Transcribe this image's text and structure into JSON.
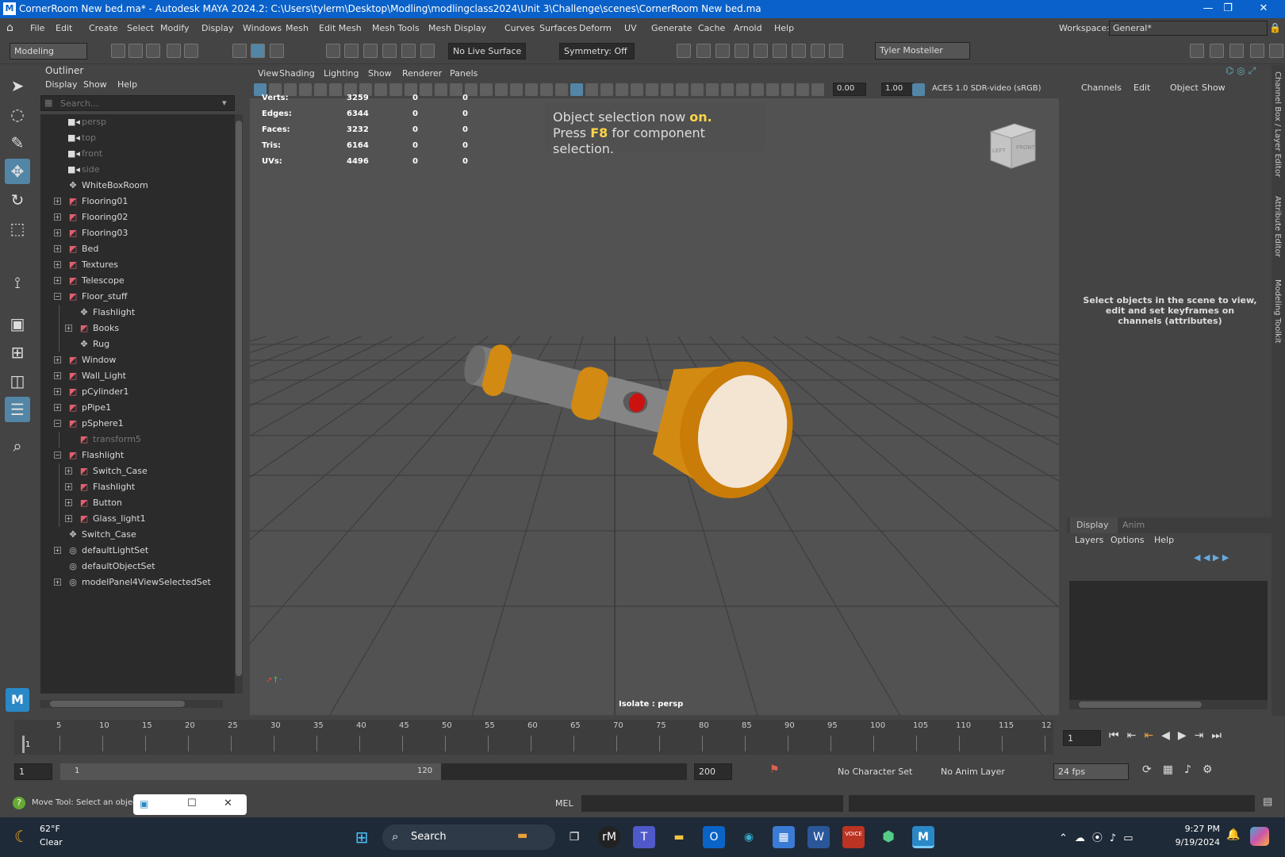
{
  "titlebar": {
    "logo": "M",
    "title": "CornerRoom New bed.ma* - Autodesk MAYA 2024.2: C:\\Users\\tylerm\\Desktop\\Modling\\modlingclass2024\\Unit 3\\Challenge\\scenes\\CornerRoom New bed.ma",
    "min": "—",
    "max": "❐",
    "close": "✕"
  },
  "menubar": {
    "items": [
      "File",
      "Edit",
      "Create",
      "Select",
      "Modify",
      "Display",
      "Windows",
      "Mesh",
      "Edit Mesh",
      "Mesh Tools",
      "Mesh Display",
      "Curves",
      "Surfaces",
      "Deform",
      "UV",
      "Generate",
      "Cache",
      "Arnold",
      "Help"
    ],
    "workspace_label": "Workspace:",
    "workspace_value": "General*"
  },
  "statusline": {
    "mode": "Modeling",
    "live_surface": "No Live Surface",
    "symmetry": "Symmetry: Off",
    "user": "Tyler Mosteller"
  },
  "outliner": {
    "title": "Outliner",
    "menus": [
      "Display",
      "Show",
      "Help"
    ],
    "search_placeholder": "Search...",
    "items": [
      {
        "label": "persp",
        "indent": 0,
        "icon": "camera-icon",
        "dim": true,
        "exp": ""
      },
      {
        "label": "top",
        "indent": 0,
        "icon": "camera-icon",
        "dim": true,
        "exp": ""
      },
      {
        "label": "front",
        "indent": 0,
        "icon": "camera-icon",
        "dim": true,
        "exp": ""
      },
      {
        "label": "side",
        "indent": 0,
        "icon": "camera-icon",
        "dim": true,
        "exp": ""
      },
      {
        "label": "WhiteBoxRoom",
        "indent": 0,
        "icon": "group-icon",
        "dim": false,
        "exp": ""
      },
      {
        "label": "Flooring01",
        "indent": 0,
        "icon": "mesh-icon",
        "dim": false,
        "exp": "+"
      },
      {
        "label": "Flooring02",
        "indent": 0,
        "icon": "mesh-icon",
        "dim": false,
        "exp": "+"
      },
      {
        "label": "Flooring03",
        "indent": 0,
        "icon": "mesh-icon",
        "dim": false,
        "exp": "+"
      },
      {
        "label": "Bed",
        "indent": 0,
        "icon": "mesh-icon",
        "dim": false,
        "exp": "+"
      },
      {
        "label": "Textures",
        "indent": 0,
        "icon": "mesh-icon",
        "dim": false,
        "exp": "+"
      },
      {
        "label": "Telescope",
        "indent": 0,
        "icon": "mesh-icon",
        "dim": false,
        "exp": "+"
      },
      {
        "label": "Floor_stuff",
        "indent": 0,
        "icon": "mesh-icon",
        "dim": false,
        "exp": "−"
      },
      {
        "label": "Flashlight",
        "indent": 1,
        "icon": "group-icon",
        "dim": false,
        "exp": ""
      },
      {
        "label": "Books",
        "indent": 1,
        "icon": "mesh-icon",
        "dim": false,
        "exp": "+"
      },
      {
        "label": "Rug",
        "indent": 1,
        "icon": "group-icon",
        "dim": false,
        "exp": ""
      },
      {
        "label": "Window",
        "indent": 0,
        "icon": "mesh-icon",
        "dim": false,
        "exp": "+"
      },
      {
        "label": "Wall_Light",
        "indent": 0,
        "icon": "mesh-icon",
        "dim": false,
        "exp": "+"
      },
      {
        "label": "pCylinder1",
        "indent": 0,
        "icon": "mesh-icon",
        "dim": false,
        "exp": "+"
      },
      {
        "label": "pPipe1",
        "indent": 0,
        "icon": "mesh-icon",
        "dim": false,
        "exp": "+"
      },
      {
        "label": "pSphere1",
        "indent": 0,
        "icon": "mesh-icon",
        "dim": false,
        "exp": "−"
      },
      {
        "label": "transform5",
        "indent": 1,
        "icon": "mesh-icon",
        "dim": true,
        "exp": ""
      },
      {
        "label": "Flashlight",
        "indent": 0,
        "icon": "mesh-icon",
        "dim": false,
        "exp": "−"
      },
      {
        "label": "Switch_Case",
        "indent": 1,
        "icon": "mesh-icon",
        "dim": false,
        "exp": "+"
      },
      {
        "label": "Flashlight",
        "indent": 1,
        "icon": "mesh-icon",
        "dim": false,
        "exp": "+"
      },
      {
        "label": "Button",
        "indent": 1,
        "icon": "mesh-icon",
        "dim": false,
        "exp": "+"
      },
      {
        "label": "Glass_light1",
        "indent": 1,
        "icon": "mesh-icon",
        "dim": false,
        "exp": "+"
      },
      {
        "label": "Switch_Case",
        "indent": 0,
        "icon": "group-icon",
        "dim": false,
        "exp": ""
      },
      {
        "label": "defaultLightSet",
        "indent": 0,
        "icon": "set-icon",
        "dim": false,
        "exp": "+"
      },
      {
        "label": "defaultObjectSet",
        "indent": 0,
        "icon": "set-icon",
        "dim": false,
        "exp": ""
      },
      {
        "label": "modelPanel4ViewSelectedSet",
        "indent": 0,
        "icon": "set-icon",
        "dim": false,
        "exp": "+"
      }
    ]
  },
  "viewport": {
    "menus": [
      "View",
      "Shading",
      "Lighting",
      "Show",
      "Renderer",
      "Panels"
    ],
    "exposure": "0.00",
    "gamma": "1.00",
    "colorspace": "ACES 1.0 SDR-video (sRGB)",
    "stats": [
      {
        "label": "Verts:",
        "v1": "3259",
        "v2": "0",
        "v3": "0"
      },
      {
        "label": "Edges:",
        "v1": "6344",
        "v2": "0",
        "v3": "0"
      },
      {
        "label": "Faces:",
        "v1": "3232",
        "v2": "0",
        "v3": "0"
      },
      {
        "label": "Tris:",
        "v1": "6164",
        "v2": "0",
        "v3": "0"
      },
      {
        "label": "UVs:",
        "v1": "4496",
        "v2": "0",
        "v3": "0"
      }
    ],
    "notice_line1_a": "Object selection now ",
    "notice_line1_b": "on.",
    "notice_line2_a": "Press ",
    "notice_line2_b": "F8",
    "notice_line2_c": " for component selection.",
    "viewcube_left": "LEFT",
    "viewcube_front": "FRONT",
    "isolate": "Isolate : persp",
    "colors": {
      "body": "#7b7b7b",
      "accent": "#d28a12",
      "button": "#cc1111",
      "lens": "#f4e4d2"
    }
  },
  "channels": {
    "menus": [
      "Channels",
      "Edit",
      "Object",
      "Show"
    ],
    "hint": "Select objects in the scene to view, edit and set keyframes on channels (attributes)",
    "tabs": [
      "Display",
      "Anim"
    ],
    "layer_menus": [
      "Layers",
      "Options",
      "Help"
    ]
  },
  "sidetabs": [
    "Channel Box / Layer Editor",
    "Attribute Editor",
    "Modeling Toolkit"
  ],
  "timeslider": {
    "ticks": [
      "5",
      "10",
      "15",
      "20",
      "25",
      "30",
      "35",
      "40",
      "45",
      "50",
      "55",
      "60",
      "65",
      "70",
      "75",
      "80",
      "85",
      "90",
      "95",
      "100",
      "105",
      "110",
      "115",
      "12"
    ],
    "current": "1",
    "current_field": "1"
  },
  "rangebar": {
    "start": "1",
    "inner_start": "1",
    "inner_end": "120",
    "end": "200",
    "character_set": "No Character Set",
    "anim_layer": "No Anim Layer",
    "fps": "24 fps"
  },
  "cmdline": {
    "help": "Move Tool: Select an object t",
    "lang": "MEL"
  },
  "taskbar": {
    "weather_temp": "62°F",
    "weather_cond": "Clear",
    "search": "Search",
    "time": "9:27 PM",
    "date": "9/19/2024"
  }
}
